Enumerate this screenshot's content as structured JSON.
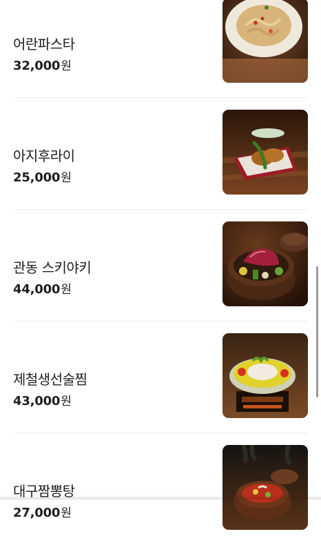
{
  "menu": {
    "items": [
      {
        "name": "어란파스타",
        "price": "32,000",
        "currency": "원",
        "image_icon": "pasta-dish-photo"
      },
      {
        "name": "아지후라이",
        "price": "25,000",
        "currency": "원",
        "image_icon": "fried-fish-photo"
      },
      {
        "name": "관동 스키야키",
        "price": "44,000",
        "currency": "원",
        "image_icon": "sukiyaki-pot-photo"
      },
      {
        "name": "제철생선술찜",
        "price": "43,000",
        "currency": "원",
        "image_icon": "steamed-fish-photo"
      },
      {
        "name": "대구짬뽕탕",
        "price": "27,000",
        "currency": "원",
        "image_icon": "seafood-stew-photo"
      }
    ]
  }
}
